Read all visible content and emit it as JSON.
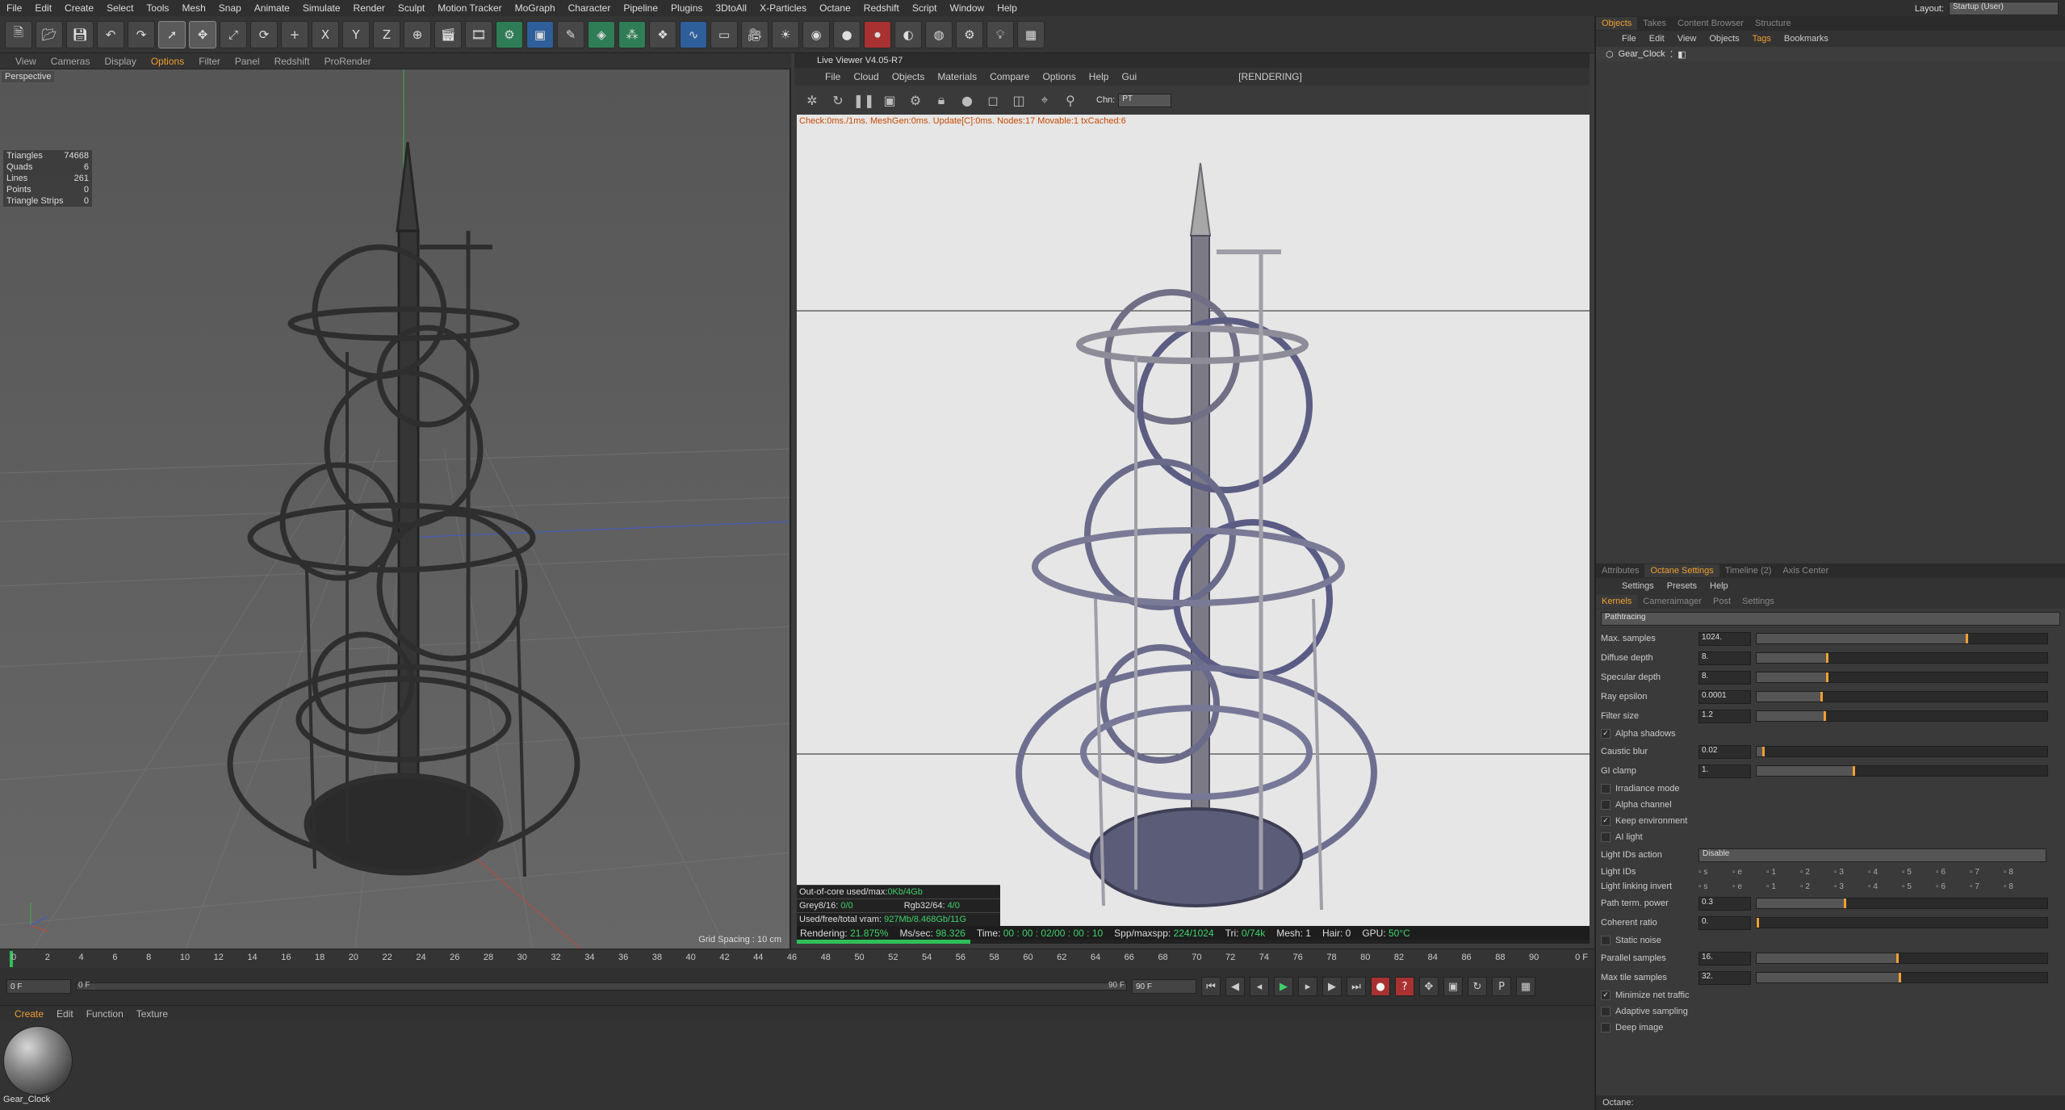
{
  "menu": [
    "File",
    "Edit",
    "Create",
    "Select",
    "Tools",
    "Mesh",
    "Snap",
    "Animate",
    "Simulate",
    "Render",
    "Sculpt",
    "Motion Tracker",
    "MoGraph",
    "Character",
    "Pipeline",
    "Plugins",
    "3DtoAll",
    "X-Particles",
    "Octane",
    "Redshift",
    "Script",
    "Window",
    "Help"
  ],
  "layout": {
    "label": "Layout:",
    "value": "Startup (User)"
  },
  "toolbar_icons": [
    "new-icon",
    "open-icon",
    "save-icon",
    "undo-icon",
    "redo-icon",
    "select-icon",
    "move-icon",
    "scale-icon",
    "rotate-icon",
    "add-icon",
    "x-axis-icon",
    "y-axis-icon",
    "z-axis-icon",
    "coords-icon",
    "render-region-icon",
    "render-view-icon",
    "render-settings-icon",
    "cube-icon",
    "pen-icon",
    "subdivide-icon",
    "array-icon",
    "cloner-icon",
    "deformer-icon",
    "floor-icon",
    "camera-icon",
    "light-icon",
    "octane-icon",
    "sphere-icon",
    "record-icon",
    "octane-live-icon",
    "hdri-icon",
    "octane-settings-icon",
    "bulb-icon",
    "layout-icon"
  ],
  "viewport": {
    "menu": [
      "View",
      "Cameras",
      "Display",
      "Options",
      "Filter",
      "Panel",
      "Redshift",
      "ProRender"
    ],
    "label": "Perspective",
    "stats": [
      [
        "Triangles",
        "74668"
      ],
      [
        "Quads",
        "6"
      ],
      [
        "Lines",
        "261"
      ],
      [
        "Points",
        "0"
      ],
      [
        "Triangle Strips",
        "0"
      ]
    ],
    "grid_spacing": "Grid Spacing : 10 cm"
  },
  "live_viewer": {
    "title": "Live Viewer V4.05-R7",
    "menu": [
      "File",
      "Cloud",
      "Objects",
      "Materials",
      "Compare",
      "Options",
      "Help",
      "Gui"
    ],
    "status": "[RENDERING]",
    "chn_label": "Chn:",
    "chn_value": "PT",
    "check_line": "Check:0ms./1ms. MeshGen:0ms. Update[C]:0ms. Nodes:17 Movable:1 txCached:6",
    "out_of_core": {
      "label": "Out-of-core used/max:",
      "value": "0Kb/4Gb"
    },
    "grey": {
      "label": "Grey8/16:",
      "value": "0/0",
      "rgb_label": "Rgb32/64:",
      "rgb_value": "4/0"
    },
    "vram": {
      "label": "Used/free/total vram:",
      "value": "927Mb/8.468Gb/11G"
    },
    "status_bar": {
      "rendering_label": "Rendering:",
      "rendering": "21.875%",
      "ms_label": "Ms/sec:",
      "ms": "98.326",
      "time_label": "Time:",
      "time": "00 : 00 : 02/00 : 00 : 10",
      "spp_label": "Spp/maxspp:",
      "spp": "224/1024",
      "tri_label": "Tri:",
      "tri": "0/74k",
      "mesh_label": "Mesh:",
      "mesh": "1",
      "hair_label": "Hair:",
      "hair": "0",
      "gpu_label": "GPU:",
      "gpu": "50°C"
    },
    "progress": 0.21875
  },
  "timeline": {
    "ticks": [
      "0",
      "2",
      "4",
      "6",
      "8",
      "10",
      "12",
      "14",
      "16",
      "18",
      "20",
      "22",
      "24",
      "26",
      "28",
      "30",
      "32",
      "34",
      "36",
      "38",
      "40",
      "42",
      "44",
      "46",
      "48",
      "50",
      "52",
      "54",
      "56",
      "58",
      "60",
      "62",
      "64",
      "66",
      "68",
      "70",
      "72",
      "74",
      "76",
      "78",
      "80",
      "82",
      "84",
      "86",
      "88",
      "90"
    ],
    "frame_end_label": "0 F",
    "start": "0 F",
    "slider_start": "0 F",
    "slider_end": "90 F",
    "end": "90 F"
  },
  "material_manager": {
    "tabs": [
      "Create",
      "Edit",
      "Function",
      "Texture"
    ],
    "material_name": "Gear_Clock"
  },
  "objects_panel": {
    "tabs": [
      "Objects",
      "Takes",
      "Content Browser",
      "Structure"
    ],
    "menu": [
      "File",
      "Edit",
      "View",
      "Objects",
      "Tags",
      "Bookmarks"
    ],
    "objects": [
      {
        "name": "Gear_Clock"
      }
    ]
  },
  "octane_panel": {
    "tabs": [
      "Attributes",
      "Octane Settings",
      "Timeline (2)",
      "Axis Center"
    ],
    "menu": [
      "Settings",
      "Presets",
      "Help"
    ],
    "subtabs": [
      "Kernels",
      "Cameraimager",
      "Post",
      "Settings"
    ],
    "kernel": "Pathtracing",
    "rows": [
      {
        "label": "Max. samples",
        "value": "1024.",
        "fill": 0.72
      },
      {
        "label": "Diffuse depth",
        "value": "8.",
        "fill": 0.24
      },
      {
        "label": "Specular depth",
        "value": "8.",
        "fill": 0.24
      },
      {
        "label": "Ray epsilon",
        "value": "0.0001",
        "fill": 0.22
      },
      {
        "label": "Filter size",
        "value": "1.2",
        "fill": 0.23
      }
    ],
    "alpha_shadows": "Alpha shadows",
    "rows2": [
      {
        "label": "Caustic blur",
        "value": "0.02",
        "fill": 0.02
      },
      {
        "label": "GI clamp",
        "value": "1.",
        "fill": 0.33
      }
    ],
    "checks": [
      "Irradiance mode",
      "Alpha channel",
      "Keep environment",
      "AI light"
    ],
    "light_ids_action_label": "Light IDs action",
    "light_ids_action": "Disable",
    "light_ids_label": "Light IDs",
    "light_linking_label": "Light linking invert",
    "light_ids": [
      "s",
      "e",
      "1",
      "2",
      "3",
      "4",
      "5",
      "6",
      "7",
      "8"
    ],
    "rows3": [
      {
        "label": "Path term. power",
        "value": "0.3",
        "fill": 0.3
      },
      {
        "label": "Coherent ratio",
        "value": "0.",
        "fill": 0.0
      }
    ],
    "static_noise": "Static noise",
    "rows4": [
      {
        "label": "Parallel samples",
        "value": "16.",
        "fill": 0.48
      },
      {
        "label": "Max tile samples",
        "value": "32.",
        "fill": 0.49
      }
    ],
    "checks2": [
      "Minimize net traffic",
      "Adaptive sampling",
      "Deep image"
    ],
    "footer": "Octane:"
  }
}
